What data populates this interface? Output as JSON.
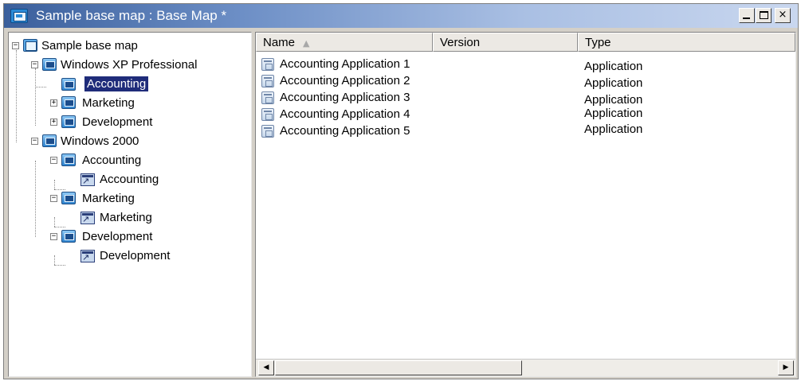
{
  "window": {
    "title": "Sample base map : Base Map *",
    "controls": {
      "minimize_icon": "minimize-icon",
      "maximize_icon": "maximize-icon",
      "close_icon": "close-icon",
      "close_label": "×"
    }
  },
  "tree": {
    "root": {
      "label": "Sample base map",
      "expander": "−"
    },
    "xp": {
      "label": "Windows XP Professional",
      "expander": "−",
      "children": [
        {
          "label": "Accounting",
          "selected": true
        },
        {
          "label": "Marketing",
          "expander": "+"
        },
        {
          "label": "Development",
          "expander": "+"
        }
      ]
    },
    "w2k": {
      "label": "Windows 2000",
      "expander": "−",
      "groups": [
        {
          "label": "Accounting",
          "expander": "−",
          "child": "Accounting"
        },
        {
          "label": "Marketing",
          "expander": "−",
          "child": "Marketing"
        },
        {
          "label": "Development",
          "expander": "−",
          "child": "Development"
        }
      ]
    }
  },
  "list": {
    "columns": [
      "Name",
      "Version",
      "Type"
    ],
    "sort_indicator": "▲",
    "rows": [
      {
        "name": "Accounting Application 1",
        "version": "",
        "type": "Application"
      },
      {
        "name": "Accounting Application 2",
        "version": "",
        "type": "Application"
      },
      {
        "name": "Accounting Application 3",
        "version": "",
        "type": "Application"
      },
      {
        "name": "Accounting Application 4",
        "version": "",
        "type": "Application"
      },
      {
        "name": "Accounting Application 5",
        "version": "",
        "type": "Application"
      }
    ]
  },
  "scrollbar": {
    "left_arrow": "◀",
    "right_arrow": "▶"
  },
  "colors": {
    "selection": "#1f2c7a",
    "title_start": "#3a5f9c",
    "title_end": "#c9d7ef"
  }
}
